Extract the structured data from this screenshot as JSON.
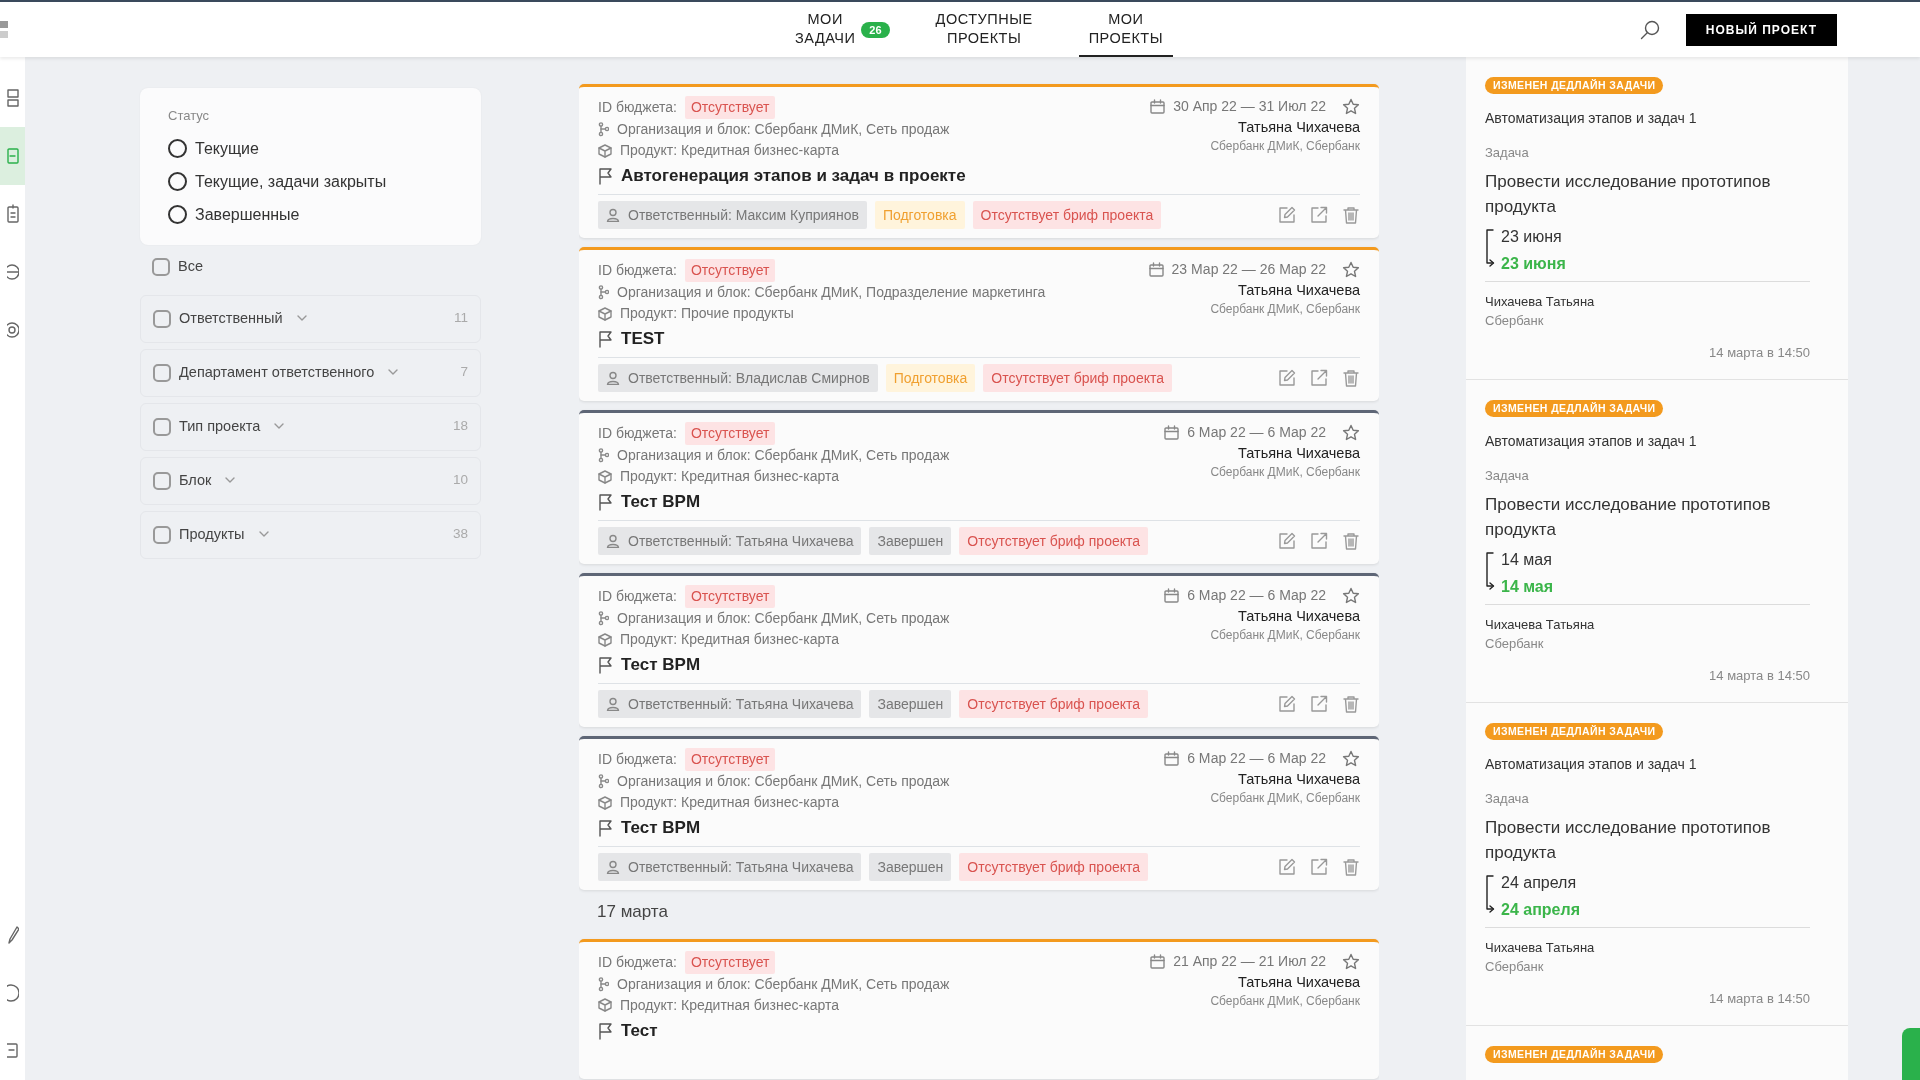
{
  "rail": {
    "top": [
      {
        "selected": false
      },
      {
        "selected": true
      },
      {
        "selected": false
      },
      {
        "selected": false
      },
      {
        "selected": false
      }
    ],
    "bottom": [
      {
        "selected": false
      },
      {
        "selected": false
      },
      {
        "selected": false
      }
    ]
  },
  "nav": {
    "tabs": [
      {
        "label": "МОИ ЗАДАЧИ",
        "badge": "26",
        "selected": false
      },
      {
        "label": "ДОСТУПНЫЕ ПРОЕКТЫ",
        "selected": false
      },
      {
        "label": "МОИ ПРОЕКТЫ",
        "selected": true
      }
    ],
    "new_project_button": "НОВЫЙ ПРОЕКТ"
  },
  "status_filter": {
    "title": "Статус",
    "options": [
      {
        "label": "Текущие",
        "selected": false
      },
      {
        "label": "Текущие, задачи закрыты",
        "selected": false
      },
      {
        "label": "Завершенные",
        "selected": false
      }
    ]
  },
  "filters": [
    {
      "kind": "plain",
      "label": "Все",
      "checked": false
    },
    {
      "kind": "group",
      "label": "Ответственный",
      "count": "11",
      "checked": false
    },
    {
      "kind": "group",
      "label": "Департамент ответственного",
      "count": "7",
      "checked": false
    },
    {
      "kind": "group",
      "label": "Тип проекта",
      "count": "18",
      "checked": false
    },
    {
      "kind": "group",
      "label": "Блок",
      "count": "10",
      "checked": false
    },
    {
      "kind": "group",
      "label": "Продукты",
      "count": "38",
      "checked": false
    }
  ],
  "feed": [
    {
      "kind": "project",
      "budget_label": "ID бюджета:",
      "budget_value": "Отсутствует",
      "org": "Организация и блок: Сбербанк ДМиК, Сеть продаж",
      "product": "Продукт: Кредитная бизнес-карта",
      "title": "Автогенерация этапов и задач в проекте",
      "dates": "30 Апр 22 — 31 Июл 22",
      "starred": false,
      "owner": "Татьяна Чихачева",
      "owner_org": "Сбербанк ДМиК, Сбербанк",
      "responsible": "Ответственный: Максим Куприянов",
      "stage": "Подготовка",
      "completed": false,
      "brief": "Отсутствует бриф проекта"
    },
    {
      "kind": "project",
      "budget_label": "ID бюджета:",
      "budget_value": "Отсутствует",
      "org": "Организация и блок: Сбербанк ДМиК, Подразделение маркетинга",
      "product": "Продукт: Прочие продукты",
      "title": "TEST",
      "dates": "23 Мар 22 — 26 Мар 22",
      "starred": false,
      "owner": "Татьяна Чихачева",
      "owner_org": "Сбербанк ДМиК, Сбербанк",
      "responsible": "Ответственный: Владислав Смирнов",
      "stage": "Подготовка",
      "completed": false,
      "brief": "Отсутствует бриф проекта"
    },
    {
      "kind": "project",
      "budget_label": "ID бюджета:",
      "budget_value": "Отсутствует",
      "org": "Организация и блок: Сбербанк ДМиК, Сеть продаж",
      "product": "Продукт: Кредитная бизнес-карта",
      "title": "Тест BPM",
      "dates": "6 Мар 22 — 6 Мар 22",
      "starred": false,
      "owner": "Татьяна Чихачева",
      "owner_org": "Сбербанк ДМиК, Сбербанк",
      "responsible": "Ответственный: Татьяна Чихачева",
      "stage": "Завершен",
      "completed": true,
      "brief": "Отсутствует бриф проекта"
    },
    {
      "kind": "project",
      "budget_label": "ID бюджета:",
      "budget_value": "Отсутствует",
      "org": "Организация и блок: Сбербанк ДМиК, Сеть продаж",
      "product": "Продукт: Кредитная бизнес-карта",
      "title": "Тест BPM",
      "dates": "6 Мар 22 — 6 Мар 22",
      "starred": false,
      "owner": "Татьяна Чихачева",
      "owner_org": "Сбербанк ДМиК, Сбербанк",
      "responsible": "Ответственный: Татьяна Чихачева",
      "stage": "Завершен",
      "completed": true,
      "brief": "Отсутствует бриф проекта"
    },
    {
      "kind": "project",
      "budget_label": "ID бюджета:",
      "budget_value": "Отсутствует",
      "org": "Организация и блок: Сбербанк ДМиК, Сеть продаж",
      "product": "Продукт: Кредитная бизнес-карта",
      "title": "Тест BPM",
      "dates": "6 Мар 22 — 6 Мар 22",
      "starred": false,
      "owner": "Татьяна Чихачева",
      "owner_org": "Сбербанк ДМиК, Сбербанк",
      "responsible": "Ответственный: Татьяна Чихачева",
      "stage": "Завершен",
      "completed": true,
      "brief": "Отсутствует бриф проекта"
    },
    {
      "kind": "date",
      "label": "17 марта"
    },
    {
      "kind": "project",
      "budget_label": "ID бюджета:",
      "budget_value": "Отсутствует",
      "org": "Организация и блок: Сбербанк ДМиК, Сеть продаж",
      "product": "Продукт: Кредитная бизнес-карта",
      "title": "Тест",
      "dates": "21 Апр 22 — 21 Июл 22",
      "starred": false,
      "owner": "Татьяна Чихачева",
      "owner_org": "Сбербанк ДМиК, Сбербанк",
      "completed": false
    }
  ],
  "notifications": [
    {
      "badge": "ИЗМЕНЕН ДЕДЛАЙН ЗАДАЧИ",
      "project": "Автоматизация этапов и задач 1",
      "type": "Задача",
      "task": "Провести исследование прототипов продукта",
      "old_date": "23 июня",
      "new_date": "23 июня",
      "person": "Чихачева Татьяна",
      "org": "Сбербанк",
      "time": "14 марта в 14:50"
    },
    {
      "badge": "ИЗМЕНЕН ДЕДЛАЙН ЗАДАЧИ",
      "project": "Автоматизация этапов и задач 1",
      "type": "Задача",
      "task": "Провести исследование прототипов продукта",
      "old_date": "14 мая",
      "new_date": "14 мая",
      "person": "Чихачева Татьяна",
      "org": "Сбербанк",
      "time": "14 марта в 14:50"
    },
    {
      "badge": "ИЗМЕНЕН ДЕДЛАЙН ЗАДАЧИ",
      "project": "Автоматизация этапов и задач 1",
      "type": "Задача",
      "task": "Провести исследование прототипов продукта",
      "old_date": "24 апреля",
      "new_date": "24 апреля",
      "person": "Чихачева Татьяна",
      "org": "Сбербанк",
      "time": "14 марта в 14:50"
    },
    {
      "badge": "ИЗМЕНЕН ДЕДЛАЙН ЗАДАЧИ"
    }
  ]
}
